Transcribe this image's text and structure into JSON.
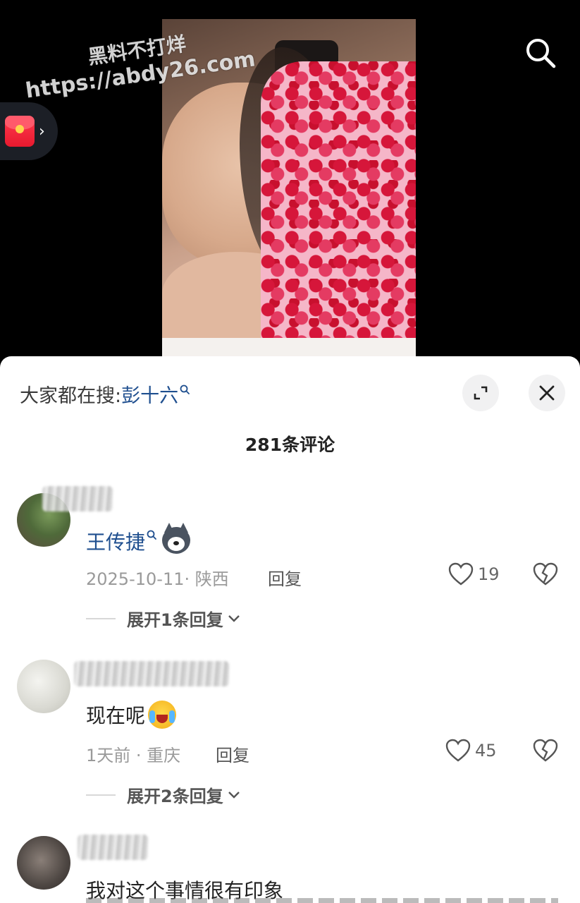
{
  "watermark": {
    "line1": "黑料不打烊",
    "line2": "https://abdy26.com"
  },
  "top_bar": {
    "search_icon": "search-icon",
    "redpacket_icon": "red-envelope-icon"
  },
  "panel": {
    "hot_search_prefix": "大家都在搜:",
    "hot_search_term": "彭十六",
    "comment_count_title": "281条评论"
  },
  "comments": [
    {
      "username": "王传捷",
      "text": "",
      "date": "2025-10-11",
      "location": "陕西",
      "meta": "2025-10-11· 陕西",
      "reply_label": "回复",
      "likes": "19",
      "expand_label": "展开1条回复"
    },
    {
      "username": "",
      "text": "现在呢",
      "meta": "1天前 · 重庆",
      "reply_label": "回复",
      "likes": "45",
      "expand_label": "展开2条回复"
    },
    {
      "username": "",
      "text": "我对这个事情很有印象"
    }
  ],
  "colors": {
    "link_blue": "#1f4f8f",
    "background_dark": "#000000",
    "panel_bg": "#ffffff"
  }
}
